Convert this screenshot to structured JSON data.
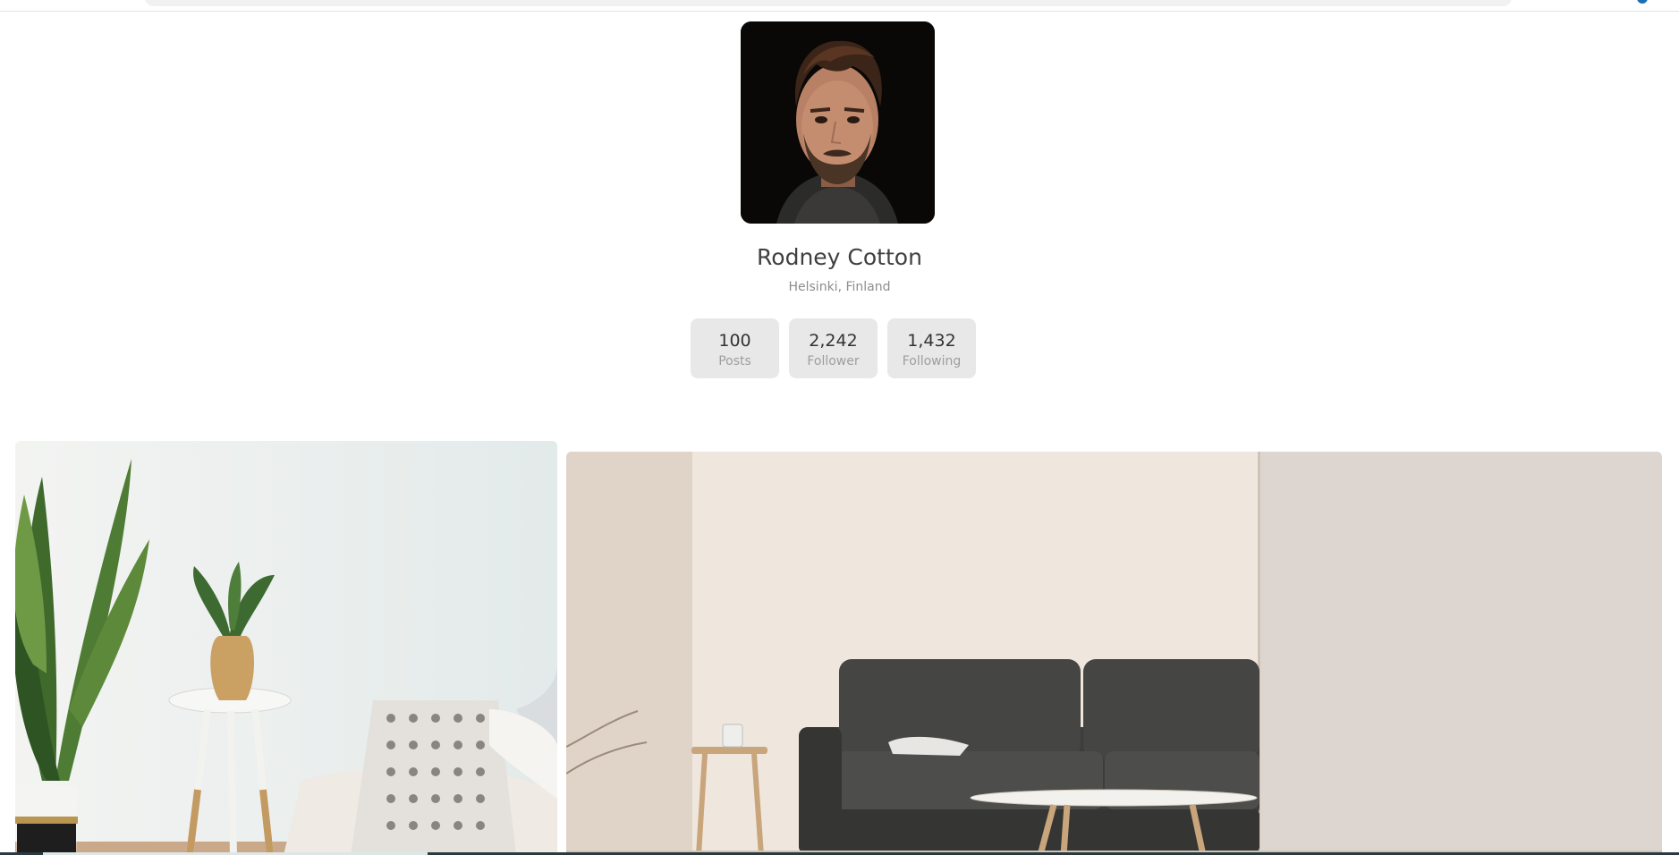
{
  "profile": {
    "name": "Rodney Cotton",
    "location": "Helsinki, Finland"
  },
  "stats": [
    {
      "value": "100",
      "label": "Posts"
    },
    {
      "value": "2,242",
      "label": "Follower"
    },
    {
      "value": "1,432",
      "label": "Following"
    }
  ],
  "posts": [
    {
      "subject": "living-room-plants-side-table"
    },
    {
      "subject": "living-room-dark-sofa"
    }
  ],
  "colors": {
    "stat_bg": "#e8e8e8",
    "name_text": "#3f3f3f",
    "muted_text": "#8d8d8d",
    "accent": "#1a6fb5"
  }
}
